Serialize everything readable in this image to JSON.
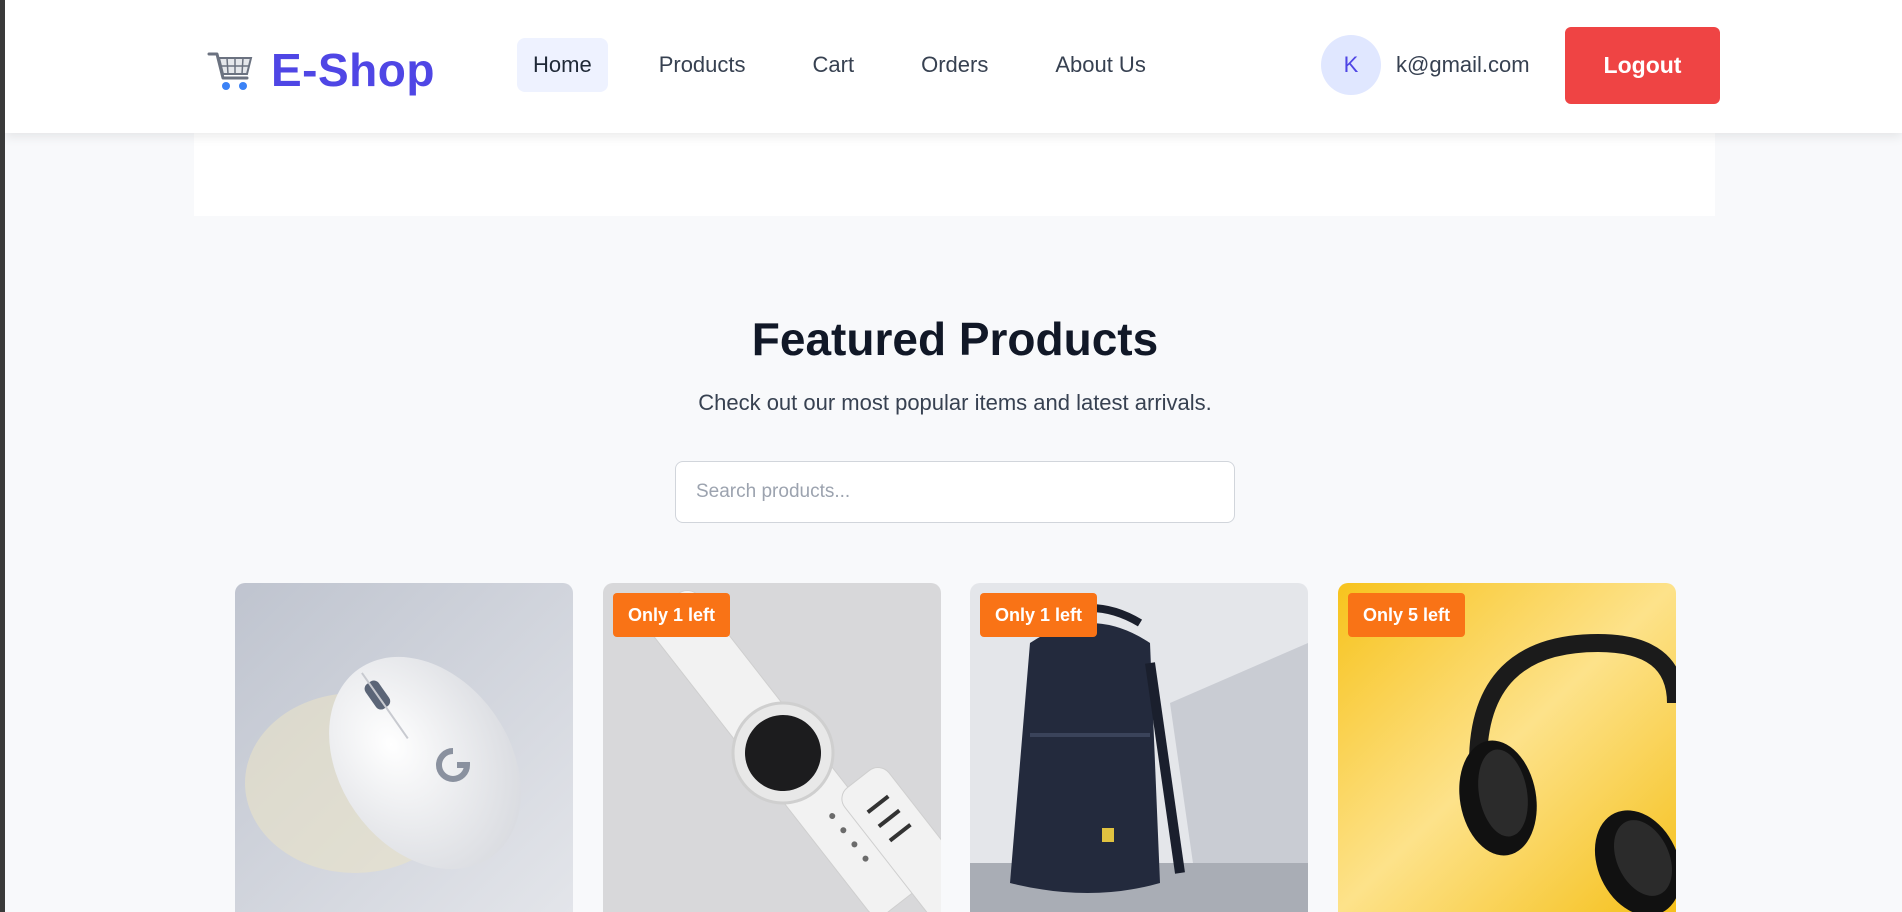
{
  "header": {
    "logo_text": "E-Shop",
    "logo_icon": "shopping-cart-icon",
    "nav": [
      {
        "label": "Home",
        "active": true
      },
      {
        "label": "Products",
        "active": false
      },
      {
        "label": "Cart",
        "active": false
      },
      {
        "label": "Orders",
        "active": false
      },
      {
        "label": "About Us",
        "active": false
      }
    ],
    "user": {
      "avatar_initial": "K",
      "email": "k@gmail.com"
    },
    "logout_label": "Logout"
  },
  "featured": {
    "title": "Featured Products",
    "subtitle": "Check out our most popular items and latest arrivals.",
    "search_placeholder": "Search products..."
  },
  "products": [
    {
      "image": "white-mouse-image",
      "badge": null
    },
    {
      "image": "white-smartwatch-image",
      "badge": "Only 1 left"
    },
    {
      "image": "navy-backpack-image",
      "badge": "Only 1 left"
    },
    {
      "image": "black-headphones-image",
      "badge": "Only 5 left"
    }
  ],
  "colors": {
    "brand": "#4f46e5",
    "logout": "#ef4444",
    "badge": "#f97316",
    "nav_active_bg": "#eef2ff"
  }
}
